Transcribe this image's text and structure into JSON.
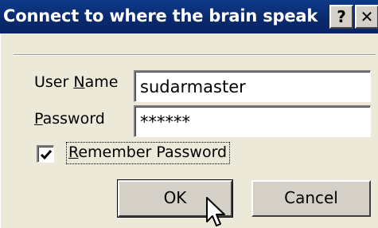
{
  "dialog": {
    "title": "Connect to where the brain speak",
    "help_glyph": "?",
    "close_glyph": "✕"
  },
  "form": {
    "username_label_first": "User ",
    "username_label_accel": "N",
    "username_label_rest": "ame",
    "username_value": "sudarmaster",
    "password_label_accel": "P",
    "password_label_rest": "assword",
    "password_value": "******",
    "remember_accel": "R",
    "remember_rest": "emember Password",
    "remember_checked": true
  },
  "buttons": {
    "ok_label": "OK",
    "cancel_label": "Cancel"
  },
  "icons": [
    "help-icon",
    "close-icon",
    "check-icon",
    "mouse-pointer-icon"
  ]
}
